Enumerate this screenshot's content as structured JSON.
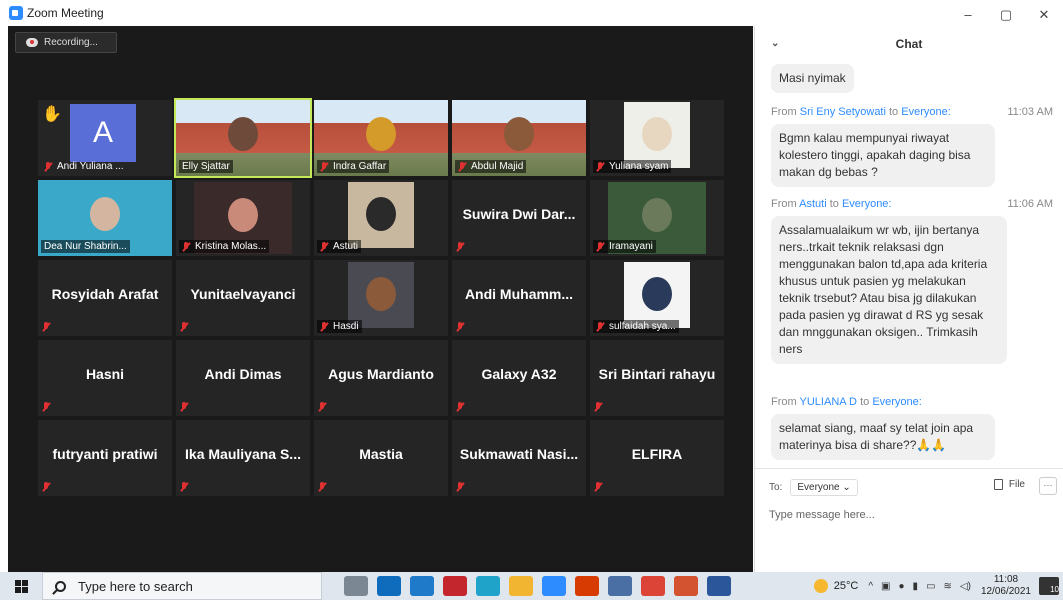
{
  "window": {
    "title": "Zoom Meeting",
    "controls": [
      "–",
      "▢",
      "✕"
    ]
  },
  "recording": {
    "label": "Recording..."
  },
  "tiles": [
    {
      "name": "Andi Yuliana ...",
      "kind": "avatar",
      "letter": "A"
    },
    {
      "name": "Elly Sjattar",
      "kind": "video",
      "active": true
    },
    {
      "name": "Indra Gaffar",
      "kind": "video"
    },
    {
      "name": "Abdul Majid",
      "kind": "video"
    },
    {
      "name": "Yuliana syam",
      "kind": "video"
    },
    {
      "name": "Dea Nur Shabrin...",
      "kind": "video"
    },
    {
      "name": "Kristina Molas...",
      "kind": "video"
    },
    {
      "name": "Astuti",
      "kind": "video"
    },
    {
      "name": "Suwira Dwi Dar...",
      "kind": "text"
    },
    {
      "name": "Iramayani",
      "kind": "video"
    },
    {
      "name": "Rosyidah Arafat",
      "kind": "text"
    },
    {
      "name": "Yunitaelvayanci",
      "kind": "text"
    },
    {
      "name": "Hasdi",
      "kind": "video"
    },
    {
      "name": "Andi Muhamm...",
      "kind": "text"
    },
    {
      "name": "sulfaidah sya...",
      "kind": "video"
    },
    {
      "name": "Hasni",
      "kind": "text"
    },
    {
      "name": "Andi Dimas",
      "kind": "text"
    },
    {
      "name": "Agus Mardianto",
      "kind": "text"
    },
    {
      "name": "Galaxy A32",
      "kind": "text"
    },
    {
      "name": "Sri Bintari rahayu",
      "kind": "text"
    },
    {
      "name": "futryanti pratiwi",
      "kind": "text"
    },
    {
      "name": "Ika Mauliyana S...",
      "kind": "text"
    },
    {
      "name": "Mastia",
      "kind": "text"
    },
    {
      "name": "Sukmawati Nasi...",
      "kind": "text"
    },
    {
      "name": "ELFIRA",
      "kind": "text"
    }
  ],
  "chat": {
    "title": "Chat",
    "messages": [
      {
        "text": "Masi nyimak"
      },
      {
        "from": "Sri Eny Setyowati",
        "to_word": "to",
        "to": "Everyone:",
        "time": "11:03 AM",
        "text": "Bgmn kalau mempunyai riwayat kolestero tinggi, apakah daging bisa makan dg bebas ?"
      },
      {
        "from": "Astuti",
        "to_word": "to",
        "to": "Everyone:",
        "time": "11:06 AM",
        "text": "Assalamualaikum wr wb, ijin bertanya ners..trkait teknik relaksasi dgn menggunakan balon td,apa ada kriteria khusus untuk pasien yg melakukan teknik trsebut? Atau bisa jg dilakukan pada pasien yg dirawat d RS yg sesak dan mnggunakan oksigen.. Trimkasih ners"
      },
      {
        "from": "YULIANA D",
        "to_word": "to",
        "to": "Everyone:",
        "text": "selamat siang, maaf sy telat join apa materinya bisa di share??🙏🙏"
      }
    ],
    "from_label": "From",
    "to_label": "To:",
    "to_value": "Everyone",
    "file_label": "File",
    "more_label": "···",
    "input_placeholder": "Type message here..."
  },
  "taskbar": {
    "search_placeholder": "Type here to search",
    "weather": "25°C",
    "time": "11:08",
    "date": "12/06/2021",
    "notifications": "10"
  }
}
